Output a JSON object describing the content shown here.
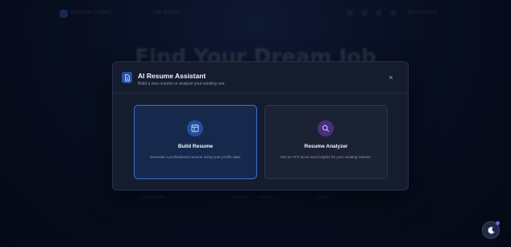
{
  "background": {
    "nav": {
      "brand": "Resume Copilot",
      "link": "Job Board",
      "user": "My Account"
    },
    "hero_title": "Find Your Dream Job"
  },
  "modal": {
    "title": "AI Resume Assistant",
    "subtitle": "Build a new resume or analyze your existing one",
    "close_label": "×",
    "icon": "document-icon",
    "options": [
      {
        "title": "Build Resume",
        "description": "Generate a professional resume using your profile data.",
        "icon": "layout-icon",
        "selected": true,
        "accent": "#3d6fd6"
      },
      {
        "title": "Resume Analyzer",
        "description": "Get an ATS score and insights for your existing resume.",
        "icon": "search-icon",
        "selected": false,
        "accent": "#7b5cf0"
      }
    ]
  },
  "fab": {
    "icon": "moon-icon"
  }
}
